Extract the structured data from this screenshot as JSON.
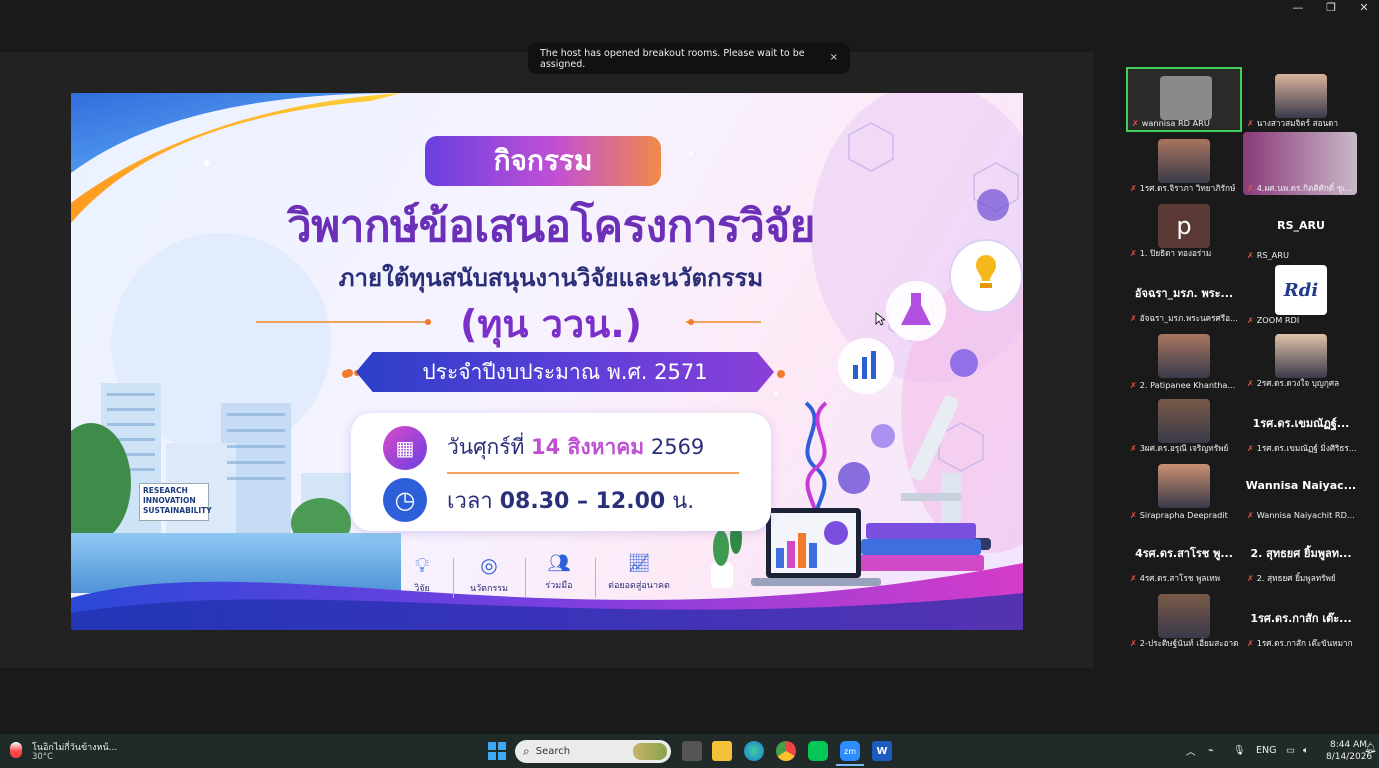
{
  "toast": {
    "text": "The host has opened breakout rooms. Please wait to be assigned.",
    "close": "×"
  },
  "slide": {
    "activity_label": "กิจกรรม",
    "title": "วิพากษ์ข้อเสนอโครงการวิจัย",
    "subtitle": "ภายใต้ทุนสนับสนุนงานวิจัยและนวัตกรรม",
    "fund": "(ทุน ววน.)",
    "fiscal_year": "ประจำปีงบประมาณ พ.ศ. 2571",
    "date_prefix": "วันศุกร์ที่",
    "date_highlight": "14 สิงหาคม",
    "date_year": "2569",
    "time_prefix": "เวลา",
    "time_value": "08.30 – 12.00",
    "time_unit": "น.",
    "building_sign": [
      "RESEARCH",
      "INNOVATION",
      "SUSTAINABILITY"
    ],
    "bottom_icons": [
      {
        "label": "วิจัย",
        "icon": "lightbulb-icon"
      },
      {
        "label": "นวัตกรรม",
        "icon": "target-icon"
      },
      {
        "label": "ร่วมมือ",
        "icon": "people-icon"
      },
      {
        "label": "ต่อยอดสู่อนาคต",
        "icon": "growth-chart-icon"
      }
    ]
  },
  "participants": [
    {
      "name": "wannisa  RD  ARU",
      "big": "",
      "kind": "video",
      "active": true
    },
    {
      "name": "นางสาวสมจิตร์ สอนดา",
      "big": "",
      "kind": "video"
    },
    {
      "name": "1รศ.ดร.จิราภา วิทยาภิรักษ์",
      "big": "",
      "kind": "video"
    },
    {
      "name": "4.ผศ.นพ.ดร.กิตติศักดิ์ ชูเ...",
      "big": "",
      "kind": "video"
    },
    {
      "name": "1. ปิยธิดา ทองอร่าม",
      "big": "",
      "kind": "avatar",
      "initial": "p"
    },
    {
      "name": "RS_ARU",
      "big": "RS_ARU",
      "kind": "text"
    },
    {
      "name": "อัจฉรา_มรภ.พระนครศรีอ...",
      "big": "อัจฉรา_มรภ. พระ...",
      "kind": "text"
    },
    {
      "name": "ZOOM RDI",
      "big": "",
      "kind": "logo",
      "logo_text": "Rdi"
    },
    {
      "name": "2. Patipanee Khantha...",
      "big": "",
      "kind": "video"
    },
    {
      "name": "2รศ.ดร.ดวงใจ บุญกุศล",
      "big": "",
      "kind": "video"
    },
    {
      "name": "3ผศ.ดร.อรุณี เจริญทรัพย์",
      "big": "",
      "kind": "video"
    },
    {
      "name": "1รศ.ดร.เขมณัฏฐ์ มิ่งศิริธร...",
      "big": "1รศ.ดร.เขมณัฏฐ์...",
      "kind": "text"
    },
    {
      "name": "Sirapraphа Deepradit",
      "big": "",
      "kind": "video"
    },
    {
      "name": "Wannisa Naiyachit RD...",
      "big": "Wannisa  Naiyac...",
      "kind": "text"
    },
    {
      "name": "4รศ.ดร.สาโรช พูลเทพ",
      "big": "4รศ.ดร.สาโรช พู...",
      "kind": "text"
    },
    {
      "name": "2. สุทธยศ ยิ้มพูลทรัพย์",
      "big": "2. สุทธยศ ยิ้มพูลท...",
      "kind": "text"
    },
    {
      "name": "2-ประดิษฐ์นันท์ เอี่ยมสะอาด",
      "big": "",
      "kind": "video"
    },
    {
      "name": "1รศ.ดร.กาสัก เต๊ะขันหมาก",
      "big": "1รศ.ดร.กาสัก เต๊ะ...",
      "kind": "text"
    }
  ],
  "taskbar": {
    "weather_text": "โนอิกไม่กี่วันข้างหน้...",
    "temperature": "30°C",
    "search_placeholder": "Search",
    "language": "ENG",
    "time": "8:44 AM",
    "date": "8/14/2026"
  },
  "colors": {
    "active_border": "#3fcf5a",
    "accent_purple": "#6b2fb8",
    "accent_orange": "#f07a2e"
  }
}
